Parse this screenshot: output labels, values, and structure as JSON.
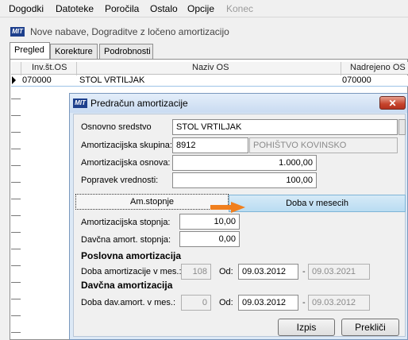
{
  "menu": [
    {
      "label": "Dogodki",
      "disabled": false
    },
    {
      "label": "Datoteke",
      "disabled": false
    },
    {
      "label": "Poročila",
      "disabled": false
    },
    {
      "label": "Ostalo",
      "disabled": false
    },
    {
      "label": "Opcije",
      "disabled": false
    },
    {
      "label": "Konec",
      "disabled": true
    }
  ],
  "app_icon_text": "MIT",
  "window_title": "Nove nabave, Dograditve z ločeno amortizacijo",
  "tabs": [
    "Pregled",
    "Korekture",
    "Podrobnosti"
  ],
  "grid": {
    "headers": {
      "inv": "Inv.št.OS",
      "naziv": "Naziv OS",
      "nadrejeno": "Nadrejeno OS"
    },
    "row": {
      "inv": "070000",
      "naziv": "STOL VRTILJAK",
      "nadrejeno": "070000"
    }
  },
  "dialog": {
    "title": "Predračun amortizacije",
    "close_symbol": "✕",
    "fields": {
      "osnovno_sredstvo_label": "Osnovno sredstvo",
      "osnovno_sredstvo_value": "STOL VRTILJAK",
      "skupina_label": "Amortizacijska skupina:",
      "skupina_code": "8912",
      "skupina_name": "POHIŠTVO KOVINSKO",
      "osnova_label": "Amortizacijska osnova:",
      "osnova_value": "1.000,00",
      "popravek_label": "Popravek vrednosti:",
      "popravek_value": "100,00"
    },
    "inner_tabs": {
      "amstopnje": "Am.stopnje",
      "doba": "Doba v mesecih"
    },
    "rates": {
      "stopnja_label": "Amortizacijska stopnja:",
      "stopnja_value": "10,00",
      "davcna_label": "Davčna amort. stopnja:",
      "davcna_value": "0,00"
    },
    "poslovna": {
      "heading": "Poslovna amortizacija",
      "doba_label": "Doba amortizacije v mes.:",
      "doba_value": "108",
      "od_label": "Od:",
      "od_value": "09.03.2012",
      "dash": "-",
      "do_value": "09.03.2021"
    },
    "davcna_am": {
      "heading": "Davčna amortizacija",
      "doba_label": "Doba dav.amort. v mes.:",
      "doba_value": "0",
      "od_label": "Od:",
      "od_value": "09.03.2012",
      "dash": "-",
      "do_value": "09.03.2012"
    },
    "buttons": {
      "izpis": "Izpis",
      "preklici": "Prekliči"
    },
    "annotation_arrow_color": "#f07f1e"
  }
}
